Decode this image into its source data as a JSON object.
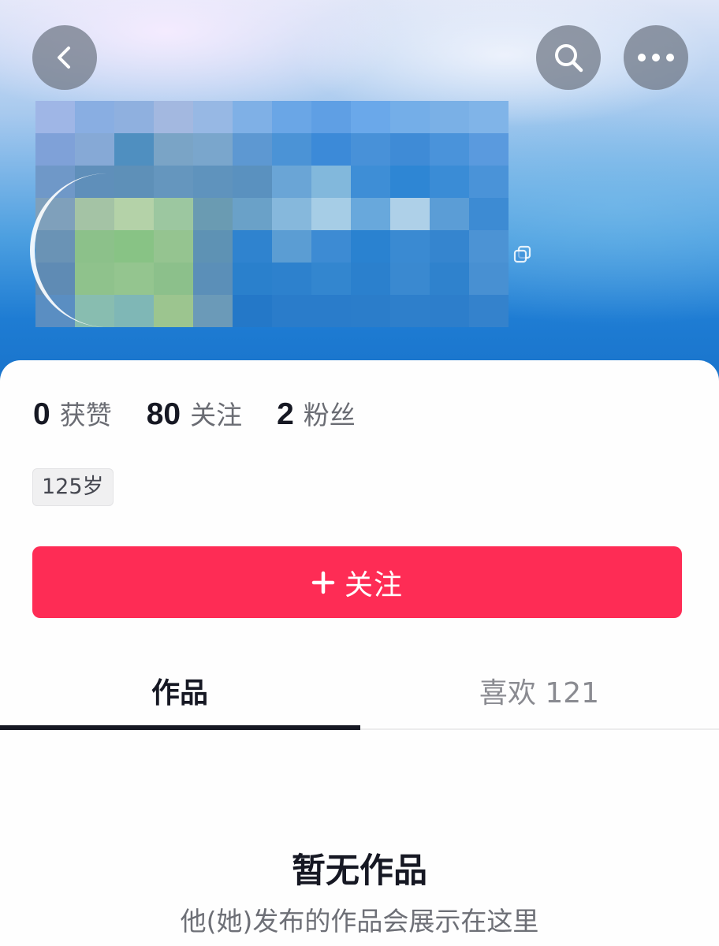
{
  "header": {
    "back_icon": "chevron-left-icon",
    "search_icon": "search-icon",
    "more_icon": "more-horizontal-icon",
    "copy_icon": "copy-icon"
  },
  "profile": {
    "stats": [
      {
        "value": "0",
        "label": "获赞"
      },
      {
        "value": "80",
        "label": "关注"
      },
      {
        "value": "2",
        "label": "粉丝"
      }
    ],
    "age_tag": "125岁"
  },
  "follow_button": {
    "icon": "plus-icon",
    "label": "关注"
  },
  "tabs": [
    {
      "label": "作品",
      "active": true
    },
    {
      "label": "喜欢 121",
      "active": false
    }
  ],
  "empty_state": {
    "title": "暂无作品",
    "subtitle": "他(她)发布的作品会展示在这里"
  },
  "colors": {
    "accent": "#fe2c55",
    "text_primary": "#161823",
    "text_secondary": "#6a6c73"
  }
}
